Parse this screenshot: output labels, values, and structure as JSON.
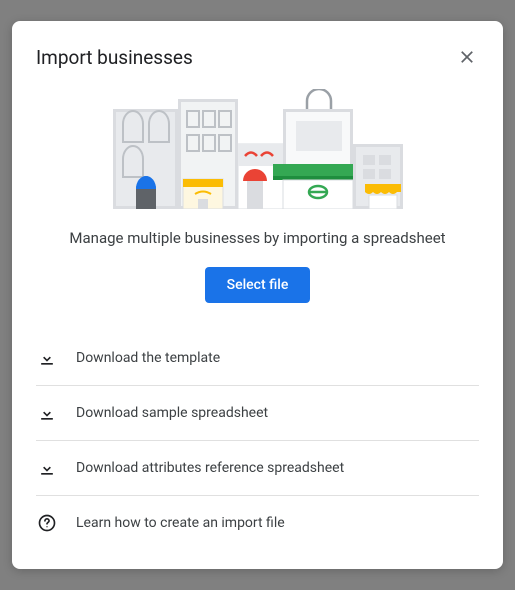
{
  "dialog": {
    "title": "Import businesses",
    "description": "Manage multiple businesses by importing a spreadsheet",
    "select_button": "Select file",
    "actions": [
      {
        "label": "Download the template",
        "icon": "download"
      },
      {
        "label": "Download sample spreadsheet",
        "icon": "download"
      },
      {
        "label": "Download attributes reference spreadsheet",
        "icon": "download"
      },
      {
        "label": "Learn how to create an import file",
        "icon": "help"
      }
    ]
  }
}
